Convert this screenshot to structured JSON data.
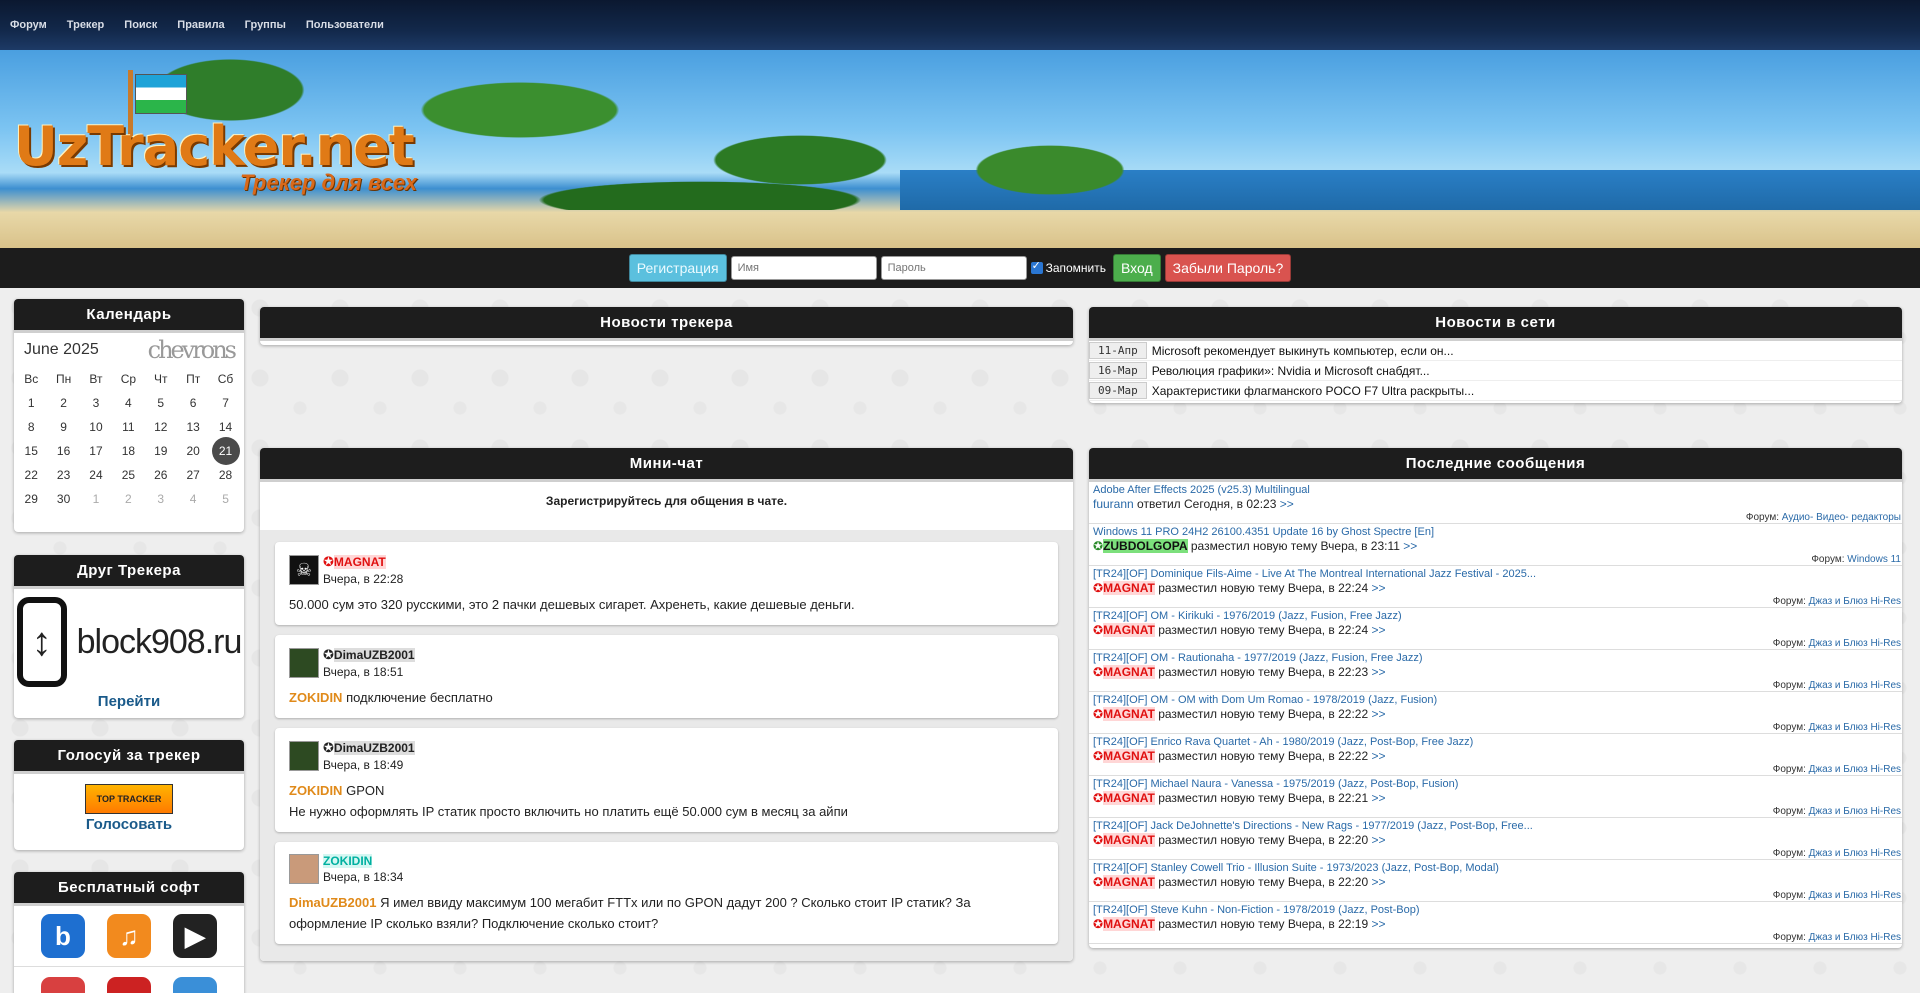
{
  "nav": {
    "items": [
      "Форум",
      "Трекер",
      "Поиск",
      "Правила",
      "Группы",
      "Пользователи"
    ]
  },
  "banner": {
    "logo_text": "UzTracker.net",
    "logo_sub": "Трекер для всех"
  },
  "login": {
    "register_label": "Регистрация",
    "name_placeholder": "Имя",
    "password_placeholder": "Пароль",
    "remember_label": "Запомнить",
    "login_label": "Вход",
    "forgot_label": "Забыли Пароль?"
  },
  "calendar": {
    "title": "Календарь",
    "month": "June 2025",
    "weekdays": [
      "Вс",
      "Пн",
      "Вт",
      "Ср",
      "Чт",
      "Пт",
      "Сб"
    ],
    "weeks": [
      [
        "1",
        "2",
        "3",
        "4",
        "5",
        "6",
        "7"
      ],
      [
        "8",
        "9",
        "10",
        "11",
        "12",
        "13",
        "14"
      ],
      [
        "15",
        "16",
        "17",
        "18",
        "19",
        "20",
        "21"
      ],
      [
        "22",
        "23",
        "24",
        "25",
        "26",
        "27",
        "28"
      ],
      [
        "29",
        "30",
        "1",
        "2",
        "3",
        "4",
        "5"
      ]
    ],
    "today": "21"
  },
  "friend": {
    "title": "Друг Трекера",
    "name": "block908.ru",
    "link_label": "Перейти"
  },
  "vote": {
    "title": "Голосуй за трекер",
    "badge_text": "TOP TRACKER",
    "link_label": "Голосовать"
  },
  "soft": {
    "title": "Бесплатный софт"
  },
  "tracker_news": {
    "title": "Новости трекера"
  },
  "net_news": {
    "title": "Новости в сети",
    "items": [
      {
        "date": "11-Апр",
        "text": "Microsoft рекомендует выкинуть компьютер, если он..."
      },
      {
        "date": "16-Мар",
        "text": "Революция графики»: Nvidia и Microsoft снабдят..."
      },
      {
        "date": "09-Мар",
        "text": "Характеристики флагманского POCO F7 Ultra раскрыты..."
      }
    ]
  },
  "chat": {
    "title": "Мини-чат",
    "note": "Зарегистрируйтесь для общения в чате.",
    "messages": [
      {
        "user": "MAGNAT",
        "time": "Вчера, в 22:28",
        "mention": "",
        "text": "50.000 сум это 320 русскими, это 2 пачки дешевых сигарет. Ахренеть, какие дешевые деньги."
      },
      {
        "user": "DimaUZB2001",
        "time": "Вчера, в 18:51",
        "mention": "ZOKIDIN",
        "text": "подключение бесплатно"
      },
      {
        "user": "DimaUZB2001",
        "time": "Вчера, в 18:49",
        "mention": "ZOKIDIN",
        "text": "GPON",
        "text2": "Не нужно оформлять IP статик просто включить но платить ещё 50.000 сум в месяц за айпи"
      },
      {
        "user": "ZOKIDIN",
        "time": "Вчера, в 18:34",
        "mention": "DimaUZB2001",
        "text": "Я имел ввиду максимум 100 мегабит FTTx или по GPON дадут 200 ? Сколько стоит IP статик? За оформление IP сколько взяли? Подключение сколько стоит?"
      }
    ]
  },
  "last_posts": {
    "title": "Последние сообщения",
    "forum_prefix": "Форум:",
    "more": ">>",
    "items": [
      {
        "title": "Adobe After Effects 2025 (v25.3) Multilingual",
        "user": "fuurann",
        "action": "ответил Сегодня, в 02:23",
        "forum": "Аудио- Видео- редакторы"
      },
      {
        "title": "Windows 11 PRO 24H2 26100.4351 Update 16 by Ghost Spectre [En]",
        "user": "ZUBDOLGOPA",
        "action": "разместил новую тему Вчера, в 23:11",
        "forum": "Windows 11"
      },
      {
        "title": "[TR24][OF] Dominique Fils-Aime - Live At The Montreal International Jazz Festival - 2025...",
        "user": "MAGNAT",
        "action": "разместил новую тему Вчера, в 22:24",
        "forum": "Джаз и Блюз Hi-Res"
      },
      {
        "title": "[TR24][OF] OM - Kirikuki - 1976/2019 (Jazz, Fusion, Free Jazz)",
        "user": "MAGNAT",
        "action": "разместил новую тему Вчера, в 22:24",
        "forum": "Джаз и Блюз Hi-Res"
      },
      {
        "title": "[TR24][OF] OM - Rautionaha - 1977/2019 (Jazz, Fusion, Free Jazz)",
        "user": "MAGNAT",
        "action": "разместил новую тему Вчера, в 22:23",
        "forum": "Джаз и Блюз Hi-Res"
      },
      {
        "title": "[TR24][OF] OM - OM with Dom Um Romao - 1978/2019 (Jazz, Fusion)",
        "user": "MAGNAT",
        "action": "разместил новую тему Вчера, в 22:22",
        "forum": "Джаз и Блюз Hi-Res"
      },
      {
        "title": "[TR24][OF] Enrico Rava Quartet - Ah - 1980/2019 (Jazz, Post-Bop, Free Jazz)",
        "user": "MAGNAT",
        "action": "разместил новую тему Вчера, в 22:22",
        "forum": "Джаз и Блюз Hi-Res"
      },
      {
        "title": "[TR24][OF] Michael Naura - Vanessa - 1975/2019 (Jazz, Post-Bop, Fusion)",
        "user": "MAGNAT",
        "action": "разместил новую тему Вчера, в 22:21",
        "forum": "Джаз и Блюз Hi-Res"
      },
      {
        "title": "[TR24][OF] Jack DeJohnette's Directions - New Rags - 1977/2019 (Jazz, Post-Bop, Free...",
        "user": "MAGNAT",
        "action": "разместил новую тему Вчера, в 22:20",
        "forum": "Джаз и Блюз Hi-Res"
      },
      {
        "title": "[TR24][OF] Stanley Cowell Trio - Illusion Suite - 1973/2023 (Jazz, Post-Bop, Modal)",
        "user": "MAGNAT",
        "action": "разместил новую тему Вчера, в 22:20",
        "forum": "Джаз и Блюз Hi-Res"
      },
      {
        "title": "[TR24][OF] Steve Kuhn - Non-Fiction - 1978/2019 (Jazz, Post-Bop)",
        "user": "MAGNAT",
        "action": "разместил новую тему Вчера, в 22:19",
        "forum": "Джаз и Блюз Hi-Res"
      }
    ]
  },
  "colors": {
    "nav_bg": "#0b1830",
    "panel_head": "#1d1d1d",
    "link": "#2a6aa8",
    "magnat": "#e01010",
    "zokidin": "#00b0a0",
    "mention": "#e08a1a"
  }
}
